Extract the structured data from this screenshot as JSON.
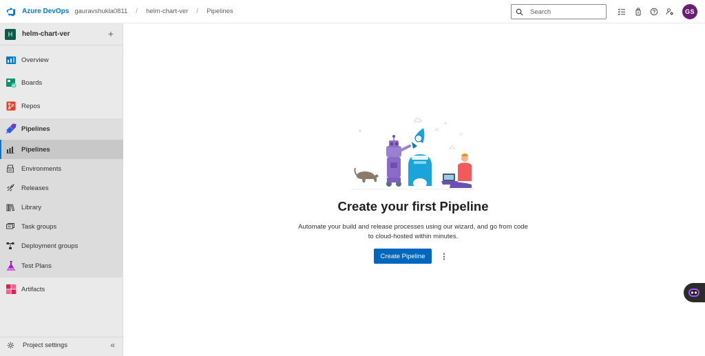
{
  "header": {
    "brand": "Azure DevOps",
    "breadcrumbs": [
      "gauravshukla0811",
      "helm-chart-ver",
      "Pipelines"
    ],
    "separator": "/",
    "search_placeholder": "Search",
    "user_initials": "GS",
    "icons": [
      "task-list-icon",
      "marketplace-bag-icon",
      "help-icon",
      "user-settings-icon"
    ]
  },
  "sidebar": {
    "project": {
      "initial": "H",
      "name": "helm-chart-ver",
      "add": "+"
    },
    "items": [
      {
        "label": "Overview",
        "icon": "overview-icon"
      },
      {
        "label": "Boards",
        "icon": "boards-icon"
      },
      {
        "label": "Repos",
        "icon": "repos-icon"
      },
      {
        "label": "Pipelines",
        "icon": "pipelines-icon"
      },
      {
        "label": "Test Plans",
        "icon": "test-plans-icon"
      },
      {
        "label": "Artifacts",
        "icon": "artifacts-icon"
      }
    ],
    "pipelines_sub": [
      {
        "label": "Pipelines",
        "icon": "pipelines-sub-icon"
      },
      {
        "label": "Environments",
        "icon": "environments-icon"
      },
      {
        "label": "Releases",
        "icon": "releases-icon"
      },
      {
        "label": "Library",
        "icon": "library-icon"
      },
      {
        "label": "Task groups",
        "icon": "task-groups-icon"
      },
      {
        "label": "Deployment groups",
        "icon": "deployment-groups-icon"
      }
    ],
    "settings": "Project settings",
    "collapse": "«"
  },
  "main": {
    "title": "Create your first Pipeline",
    "description": "Automate your build and release processes using our wizard, and go from code to cloud-hosted within minutes.",
    "primary_button": "Create Pipeline",
    "more": "⋮"
  },
  "colors": {
    "accent": "#0078d4",
    "primary_button": "#0067c0",
    "avatar": "#6b1c74",
    "project_badge": "#0b5c4b"
  }
}
